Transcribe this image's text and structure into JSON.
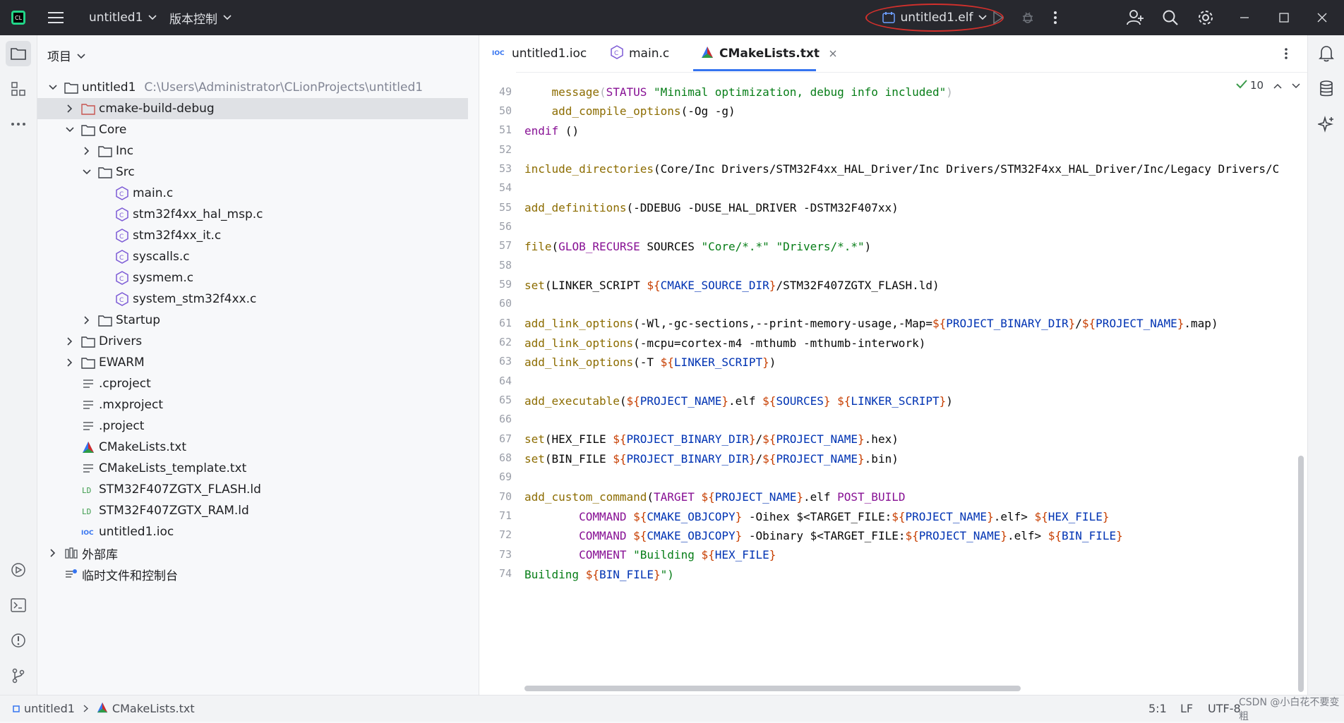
{
  "titlebar": {
    "project_name": "untitled1",
    "vcs_menu": "版本控制",
    "run_config": "untitled1.elf"
  },
  "project_panel": {
    "header": "项目",
    "root": "untitled1",
    "root_path": "C:\\Users\\Administrator\\CLionProjects\\untitled1",
    "items": [
      "cmake-build-debug",
      "Core",
      "Inc",
      "Src",
      "main.c",
      "stm32f4xx_hal_msp.c",
      "stm32f4xx_it.c",
      "syscalls.c",
      "sysmem.c",
      "system_stm32f4xx.c",
      "Startup",
      "Drivers",
      "EWARM",
      ".cproject",
      ".mxproject",
      ".project",
      "CMakeLists.txt",
      "CMakeLists_template.txt",
      "STM32F407ZGTX_FLASH.ld",
      "STM32F407ZGTX_RAM.ld",
      "untitled1.ioc",
      "外部库",
      "临时文件和控制台"
    ]
  },
  "tabs": [
    {
      "label": "untitled1.ioc",
      "badge": "IOC"
    },
    {
      "label": "main.c"
    },
    {
      "label": "CMakeLists.txt"
    }
  ],
  "editor": {
    "inspection_count": "10",
    "line_numbers": [
      "49",
      "50",
      "51",
      "52",
      "53",
      "54",
      "55",
      "56",
      "57",
      "58",
      "59",
      "60",
      "61",
      "62",
      "63",
      "64",
      "65",
      "66",
      "67",
      "68",
      "69",
      "70",
      "71",
      "72",
      "73",
      "74"
    ],
    "lines": [
      "    message(STATUS \"Minimal optimization, debug info included\")",
      "    add_compile_options(-Og -g)",
      "endif ()",
      "",
      "include_directories(Core/Inc Drivers/STM32F4xx_HAL_Driver/Inc Drivers/STM32F4xx_HAL_Driver/Inc/Legacy Drivers/C",
      "",
      "add_definitions(-DDEBUG -DUSE_HAL_DRIVER -DSTM32F407xx)",
      "",
      "file(GLOB_RECURSE SOURCES \"Core/*.*\" \"Drivers/*.*\")",
      "",
      "set(LINKER_SCRIPT ${CMAKE_SOURCE_DIR}/STM32F407ZGTX_FLASH.ld)",
      "",
      "add_link_options(-Wl,-gc-sections,--print-memory-usage,-Map=${PROJECT_BINARY_DIR}/${PROJECT_NAME}.map)",
      "add_link_options(-mcpu=cortex-m4 -mthumb -mthumb-interwork)",
      "add_link_options(-T ${LINKER_SCRIPT})",
      "",
      "add_executable(${PROJECT_NAME}.elf ${SOURCES} ${LINKER_SCRIPT})",
      "",
      "set(HEX_FILE ${PROJECT_BINARY_DIR}/${PROJECT_NAME}.hex)",
      "set(BIN_FILE ${PROJECT_BINARY_DIR}/${PROJECT_NAME}.bin)",
      "",
      "add_custom_command(TARGET ${PROJECT_NAME}.elf POST_BUILD",
      "        COMMAND ${CMAKE_OBJCOPY} -Oihex $<TARGET_FILE:${PROJECT_NAME}.elf> ${HEX_FILE}",
      "        COMMAND ${CMAKE_OBJCOPY} -Obinary $<TARGET_FILE:${PROJECT_NAME}.elf> ${BIN_FILE}",
      "        COMMENT \"Building ${HEX_FILE}",
      "Building ${BIN_FILE}\")"
    ]
  },
  "statusbar": {
    "crumb_project": "untitled1",
    "crumb_file": "CMakeLists.txt",
    "position": "5:1",
    "line_sep": "LF",
    "encoding": "UTF-8",
    "watermark": "CSDN @小白花不要变粗"
  },
  "colors": {
    "titlebar_bg": "#27282e",
    "accent": "#3574f0",
    "highlight_oval": "#d2302c",
    "keyword": "#871094",
    "function": "#8c6c00",
    "string": "#067d17",
    "variable": "#0033b3"
  }
}
